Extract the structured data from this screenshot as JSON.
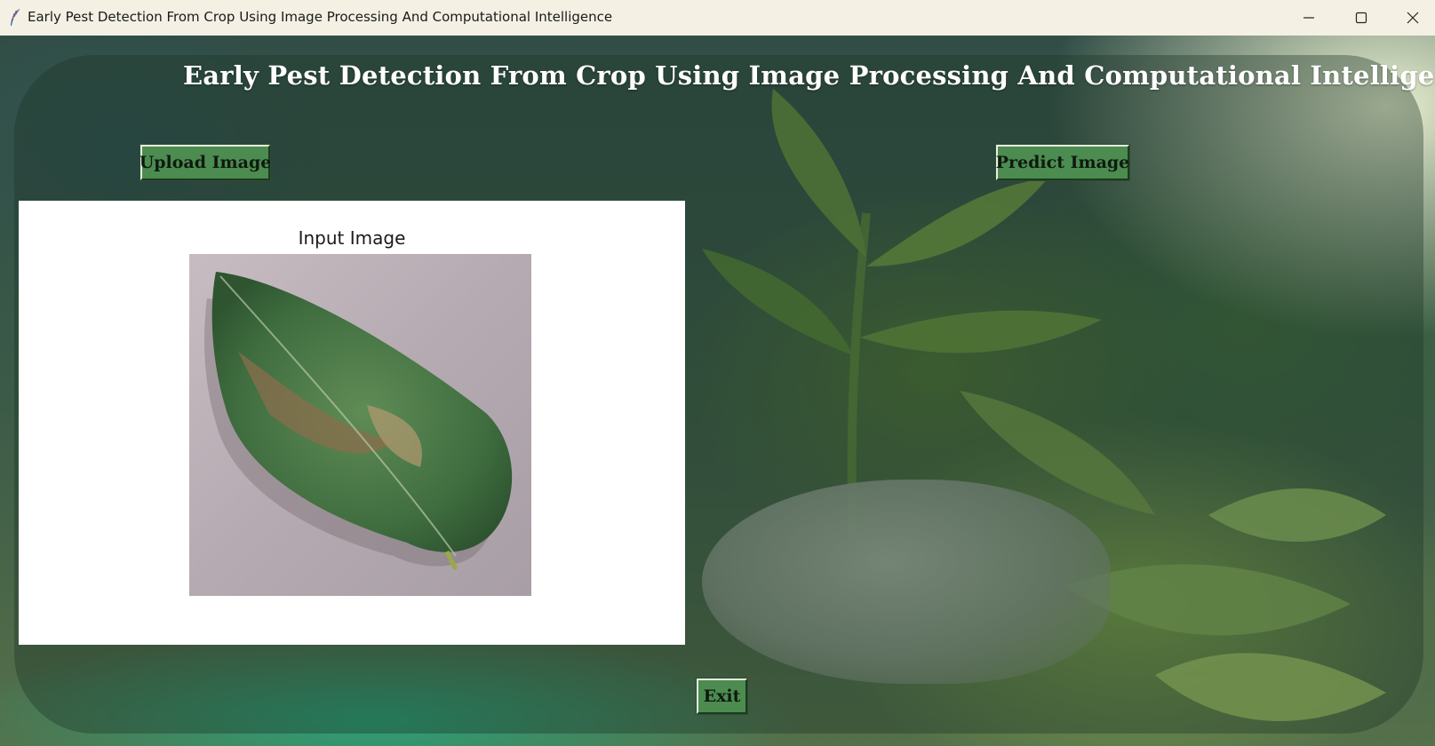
{
  "window": {
    "title": "Early Pest Detection From Crop Using Image Processing And Computational Intelligence",
    "icon": "feather-icon",
    "controls": [
      "minimize-icon",
      "maximize-icon",
      "close-icon"
    ]
  },
  "app": {
    "heading": "Early Pest Detection From Crop Using Image Processing And Computational Intelligence"
  },
  "buttons": {
    "upload_label": "Upload Image",
    "predict_label": "Predict Image",
    "exit_label": "Exit"
  },
  "figure": {
    "title": "Input Image"
  },
  "colors": {
    "button_bg": "#4c8c50",
    "heading_text": "#ffffff",
    "titlebar_bg": "#f4f1e4"
  }
}
